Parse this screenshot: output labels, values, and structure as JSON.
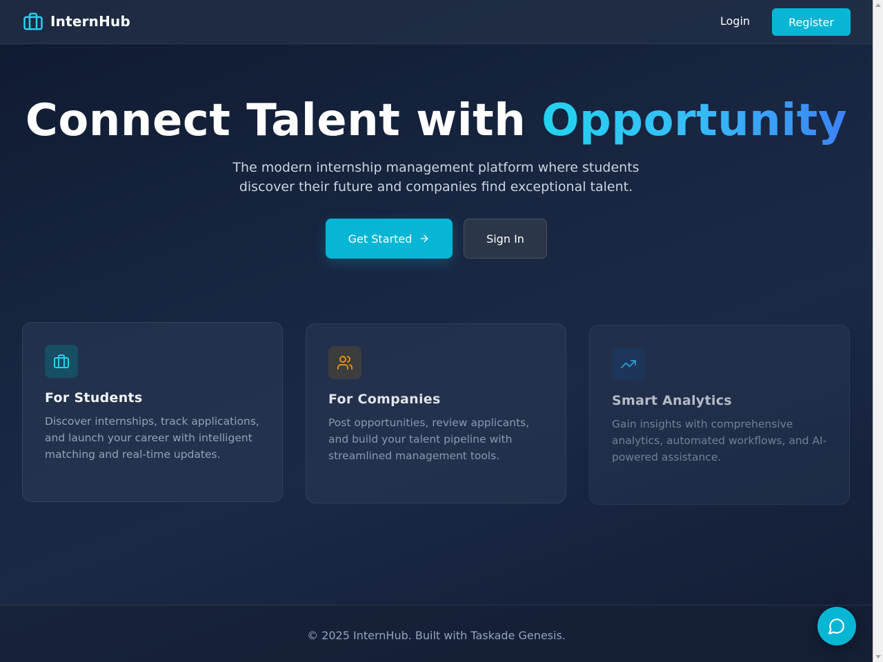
{
  "brand": {
    "name": "InternHub",
    "icon": "briefcase-icon",
    "accent_color": "#06b6d4"
  },
  "nav": {
    "login_label": "Login",
    "register_label": "Register"
  },
  "hero": {
    "title_plain": "Connect Talent with ",
    "title_accent": "Opportunity",
    "subtitle": "The modern internship management platform where students discover their future and companies find exceptional talent.",
    "primary_cta": "Get Started",
    "primary_cta_icon": "arrow-right-icon",
    "secondary_cta": "Sign In"
  },
  "features": [
    {
      "icon": "briefcase-icon",
      "icon_color": "#22d3ee",
      "title": "For Students",
      "description": "Discover internships, track applications, and launch your career with intelligent matching and real-time updates."
    },
    {
      "icon": "users-icon",
      "icon_color": "#f59e0b",
      "title": "For Companies",
      "description": "Post opportunities, review applicants, and build your talent pipeline with streamlined management tools."
    },
    {
      "icon": "trending-up-icon",
      "icon_color": "#38bdf8",
      "title": "Smart Analytics",
      "description": "Gain insights with comprehensive analytics, automated workflows, and AI-powered assistance."
    }
  ],
  "footer": {
    "text": "© 2025 InternHub. Built with Taskade Genesis."
  },
  "chat": {
    "icon": "chat-bubble-icon"
  }
}
